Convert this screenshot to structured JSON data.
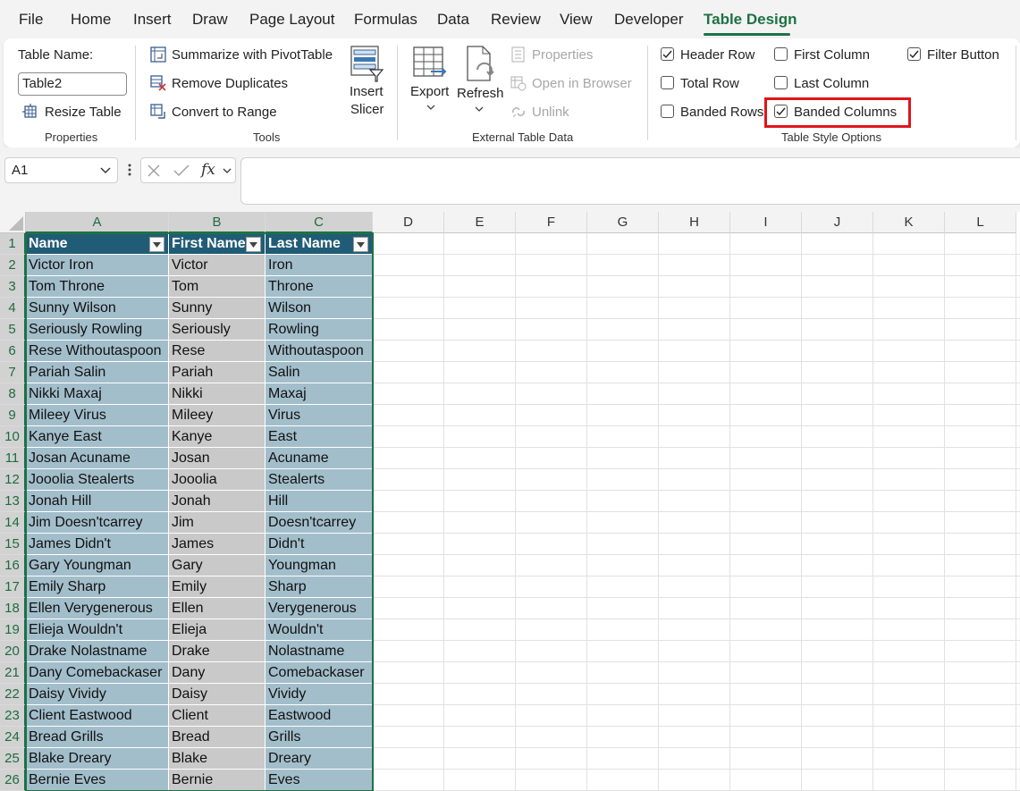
{
  "menu": {
    "tabs": [
      "File",
      "Home",
      "Insert",
      "Draw",
      "Page Layout",
      "Formulas",
      "Data",
      "Review",
      "View",
      "Developer",
      "Table Design"
    ],
    "active": "Table Design"
  },
  "ribbon": {
    "properties": {
      "table_name_label": "Table Name:",
      "table_name_value": "Table2",
      "resize_label": "Resize Table",
      "group_label": "Properties"
    },
    "tools": {
      "summarize_label": "Summarize with PivotTable",
      "remove_dup_label": "Remove Duplicates",
      "convert_label": "Convert to Range",
      "insert_slicer_line1": "Insert",
      "insert_slicer_line2": "Slicer",
      "group_label": "Tools"
    },
    "external": {
      "export_label": "Export",
      "refresh_label": "Refresh",
      "properties_label": "Properties",
      "open_browser_label": "Open in Browser",
      "unlink_label": "Unlink",
      "group_label": "External Table Data"
    },
    "style_options": {
      "header_row": {
        "label": "Header Row",
        "checked": true
      },
      "total_row": {
        "label": "Total Row",
        "checked": false
      },
      "banded_rows": {
        "label": "Banded Rows",
        "checked": false
      },
      "first_column": {
        "label": "First Column",
        "checked": false
      },
      "last_column": {
        "label": "Last Column",
        "checked": false
      },
      "banded_columns": {
        "label": "Banded Columns",
        "checked": true
      },
      "filter_button": {
        "label": "Filter Button",
        "checked": true
      },
      "group_label": "Table Style Options"
    }
  },
  "formula_bar": {
    "name_box": "A1",
    "fx_label": "fx",
    "formula": ""
  },
  "sheet": {
    "columns": [
      "A",
      "B",
      "C",
      "D",
      "E",
      "F",
      "G",
      "H",
      "I",
      "J",
      "K",
      "L"
    ],
    "headers": [
      "Name",
      "First Name",
      "Last Name"
    ],
    "rows": [
      [
        "Victor Iron",
        "Victor",
        "Iron"
      ],
      [
        "Tom Throne",
        "Tom",
        "Throne"
      ],
      [
        "Sunny Wilson",
        "Sunny",
        "Wilson"
      ],
      [
        "Seriously Rowling",
        "Seriously",
        "Rowling"
      ],
      [
        "Rese Withoutaspoon",
        "Rese",
        "Withoutaspoon"
      ],
      [
        "Pariah Salin",
        "Pariah",
        "Salin"
      ],
      [
        "Nikki Maxaj",
        "Nikki",
        "Maxaj"
      ],
      [
        "Mileey Virus",
        "Mileey",
        "Virus"
      ],
      [
        "Kanye East",
        "Kanye",
        "East"
      ],
      [
        "Josan Acuname",
        "Josan",
        "Acuname"
      ],
      [
        "Jooolia Stealerts",
        "Jooolia",
        "Stealerts"
      ],
      [
        "Jonah Hill",
        "Jonah",
        "Hill"
      ],
      [
        "Jim Doesn'tcarrey",
        "Jim",
        "Doesn'tcarrey"
      ],
      [
        "James Didn't",
        "James",
        "Didn't"
      ],
      [
        "Gary Youngman",
        "Gary",
        "Youngman"
      ],
      [
        "Emily Sharp",
        "Emily",
        "Sharp"
      ],
      [
        "Ellen Verygenerous",
        "Ellen",
        "Verygenerous"
      ],
      [
        "Elieja Wouldn't",
        "Elieja",
        "Wouldn't"
      ],
      [
        "Drake Nolastname",
        "Drake",
        "Nolastname"
      ],
      [
        "Dany Comebackaser",
        "Dany",
        "Comebackaser"
      ],
      [
        "Daisy Vividy",
        "Daisy",
        "Vividy"
      ],
      [
        "Client Eastwood",
        "Client",
        "Eastwood"
      ],
      [
        "Bread Grills",
        "Bread",
        "Grills"
      ],
      [
        "Blake Dreary",
        "Blake",
        "Dreary"
      ],
      [
        "Bernie Eves",
        "Bernie",
        "Eves"
      ]
    ]
  },
  "colors": {
    "accent": "#1e7145",
    "table_header": "#215c76",
    "band_blue": "#a3becb",
    "band_gray": "#c9c9c9",
    "highlight": "#e0151b"
  }
}
